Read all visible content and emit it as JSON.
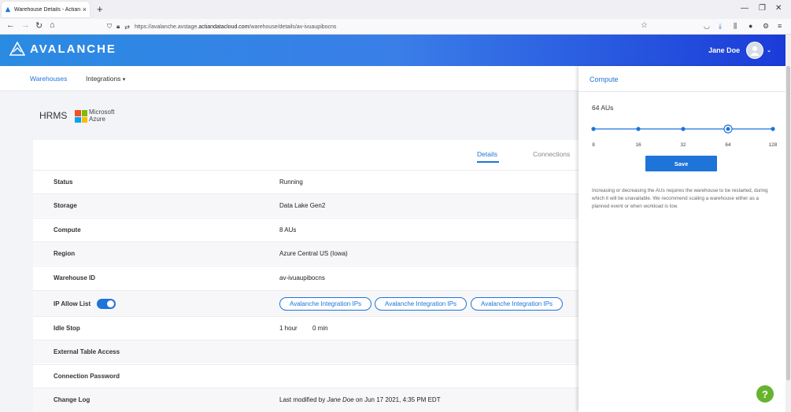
{
  "browser": {
    "tab_title": "Warehouse Details - Actian Ava",
    "url_prefix": "https://avalanche.avstage.",
    "url_domain": "actiandatacloud.com",
    "url_path": "/warehouse/details/av-ivuaupibocns"
  },
  "header": {
    "brand": "AVALANCHE",
    "user_name": "Jane Doe"
  },
  "subnav": {
    "warehouses": "Warehouses",
    "integrations": "Integrations"
  },
  "warehouse": {
    "name": "HRMS",
    "provider_line1": "Microsoft",
    "provider_line2": "Azure"
  },
  "tabs": {
    "details": "Details",
    "connections": "Connections"
  },
  "rows": [
    {
      "label": "Status",
      "value": "Running"
    },
    {
      "label": "Storage",
      "value": "Data Lake Gen2"
    },
    {
      "label": "Compute",
      "value": "8 AUs"
    },
    {
      "label": "Region",
      "value": "Azure Central US (Iowa)"
    },
    {
      "label": "Warehouse ID",
      "value": "av-ivuaupibocns"
    },
    {
      "label": "IP Allow List",
      "value": ""
    },
    {
      "label": "Idle Stop",
      "value": "1 hour",
      "value2": "0 min"
    },
    {
      "label": "External Table Access",
      "value": ""
    },
    {
      "label": "Connection Password",
      "value": ""
    },
    {
      "label": "Change Log",
      "value_pre": "Last modified by ",
      "value_user": "Jane Doe",
      "value_post": " on Jun 17 2021, 4:35 PM EDT"
    }
  ],
  "ip_buttons": [
    "Avalanche Integration IPs",
    "Avalanche Integration IPs",
    "Avalanche Integration IPs"
  ],
  "panel": {
    "title": "Compute",
    "au_label": "64 AUs",
    "slider_ticks": [
      "8",
      "16",
      "32",
      "64",
      "128"
    ],
    "slider_selected_index": 3,
    "save": "Save",
    "note": "Increasing or decreasing the AUs requires the warehouse to be restarted, during which it will be unavailable. We recommend scaling a warehouse either as a planned event or when workload is low."
  },
  "help": "?",
  "colors": {
    "accent": "#1e74d8",
    "help": "#67b32e"
  }
}
